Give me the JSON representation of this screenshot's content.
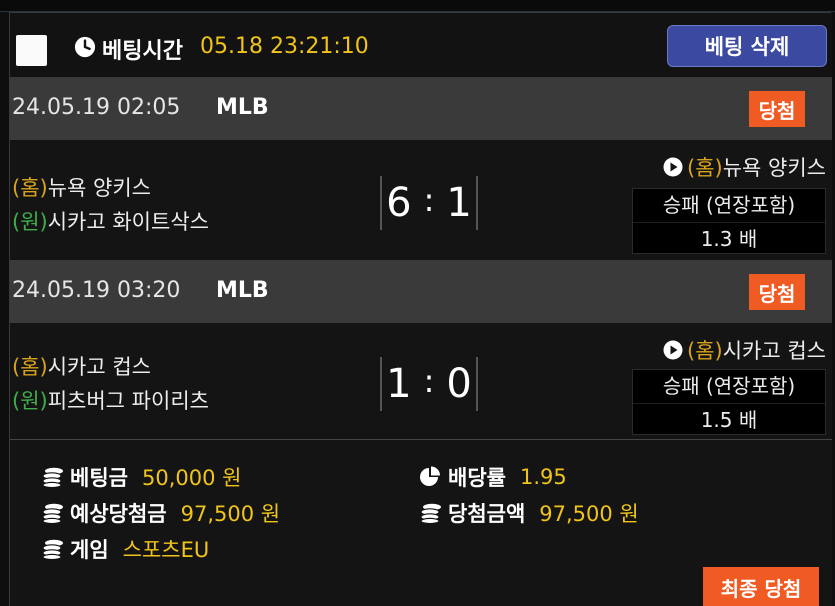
{
  "header": {
    "bet_time_label": "베팅시간",
    "bet_time_value": "05.18 23:21:10",
    "delete_button": "베팅 삭제"
  },
  "games": [
    {
      "date": "24.05.19 02:05",
      "league": "MLB",
      "result": "당첨",
      "home_tag": "(홈)",
      "home_team": "뉴욕 양키스",
      "away_tag": "(원)",
      "away_team": "시카고 화이트삭스",
      "home_score": "6",
      "away_score": "1",
      "pick_tag": "(홈)",
      "pick_team": "뉴욕 양키스",
      "market": "승패 (연장포함)",
      "odds": "1.3 배"
    },
    {
      "date": "24.05.19 03:20",
      "league": "MLB",
      "result": "당첨",
      "home_tag": "(홈)",
      "home_team": "시카고 컵스",
      "away_tag": "(원)",
      "away_team": "피츠버그 파이리츠",
      "home_score": "1",
      "away_score": "0",
      "pick_tag": "(홈)",
      "pick_team": " 시카고 컵스",
      "market": "승패 (연장포함)",
      "odds": "1.5 배"
    }
  ],
  "summary": {
    "bet_amount_label": "베팅금",
    "bet_amount_value": "50,000 원",
    "expected_win_label": "예상당첨금",
    "expected_win_value": "97,500 원",
    "game_label": "게임",
    "game_value": "스포츠EU",
    "odds_rate_label": "배당률",
    "odds_rate_value": "1.95",
    "win_amount_label": "당첨금액",
    "win_amount_value": "97,500 원",
    "final_button": "최종 당첨"
  },
  "colors": {
    "accent_yellow": "#f0c419",
    "badge_orange": "#f05a23",
    "button_blue": "#3b4aa0",
    "home_tag": "#d9a41c",
    "away_tag": "#3fae4a"
  },
  "icons": {
    "clock": "clock-icon",
    "play": "play-icon",
    "coins": "coins-icon",
    "pie": "pie-chart-icon"
  }
}
